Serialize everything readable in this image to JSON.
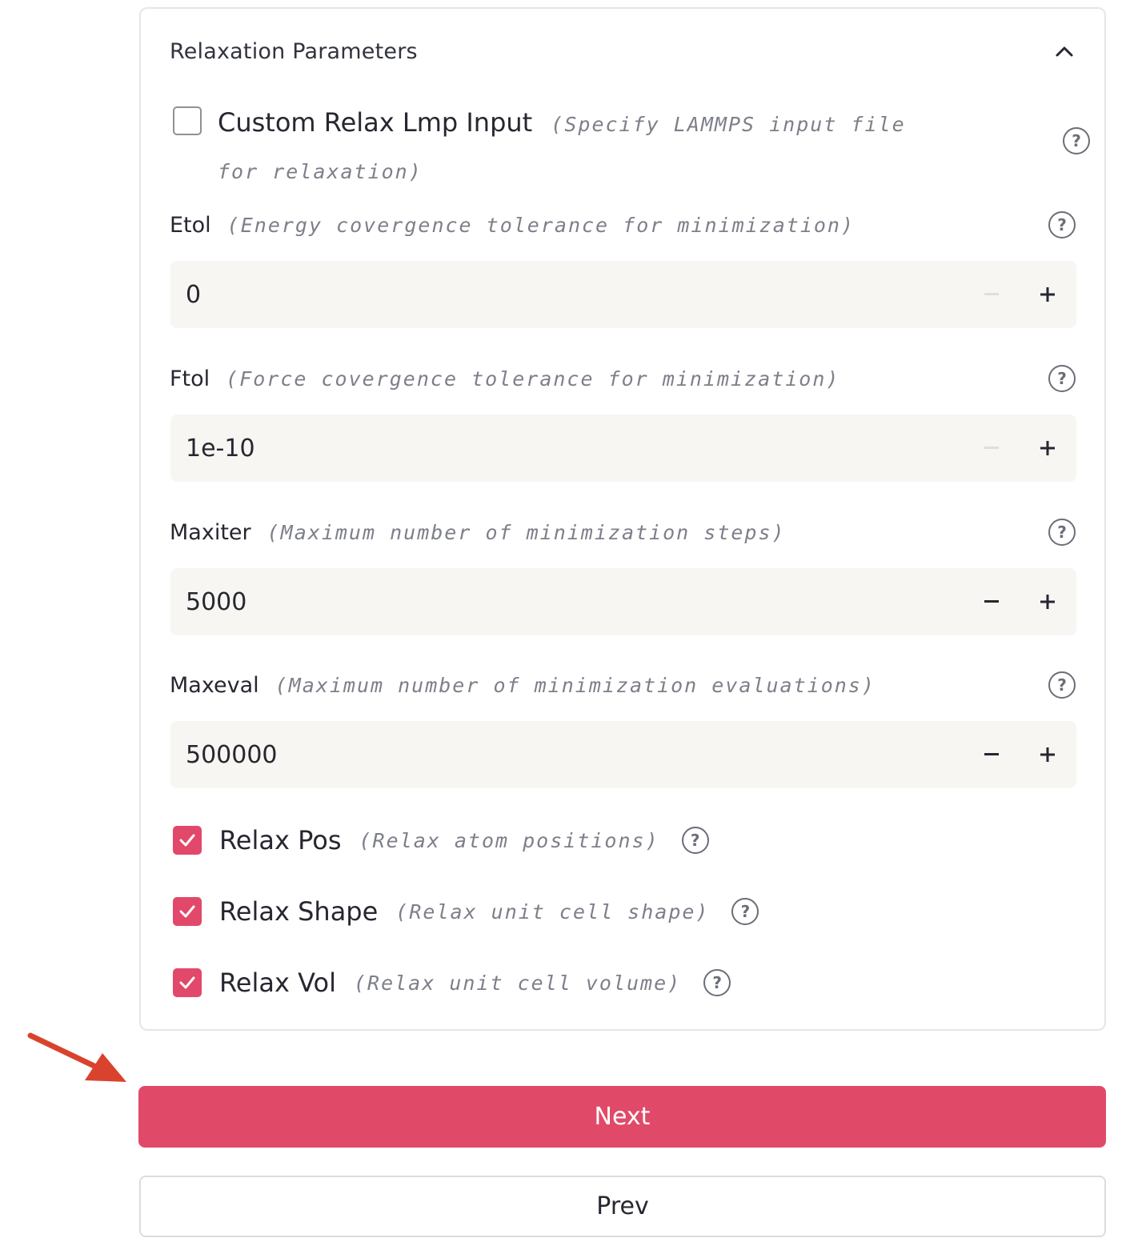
{
  "panel": {
    "title": "Relaxation Parameters"
  },
  "custom_relax": {
    "label": "Custom Relax Lmp Input",
    "description": "(Specify LAMMPS input file for relaxation)",
    "checked": false
  },
  "fields": [
    {
      "name": "Etol",
      "description": "(Energy covergence tolerance for minimization)",
      "value": "0"
    },
    {
      "name": "Ftol",
      "description": "(Force covergence tolerance for minimization)",
      "value": "1e-10"
    },
    {
      "name": "Maxiter",
      "description": "(Maximum number of minimization steps)",
      "value": "5000"
    },
    {
      "name": "Maxeval",
      "description": "(Maximum number of minimization evaluations)",
      "value": "500000"
    }
  ],
  "checkboxes": [
    {
      "label": "Relax Pos",
      "description": "(Relax atom positions)",
      "checked": true
    },
    {
      "label": "Relax Shape",
      "description": "(Relax unit cell shape)",
      "checked": true
    },
    {
      "label": "Relax Vol",
      "description": "(Relax unit cell volume)",
      "checked": true
    }
  ],
  "buttons": {
    "next": "Next",
    "prev": "Prev"
  },
  "icons": {
    "help": "?",
    "collapse": "chevron-up-icon",
    "increment": "plus-icon",
    "decrement": "minus-icon",
    "checkmark": "check-icon"
  },
  "colors": {
    "accent": "#e04a68",
    "annotation_arrow": "#d9432d",
    "input_bg": "#f8f6f2"
  }
}
